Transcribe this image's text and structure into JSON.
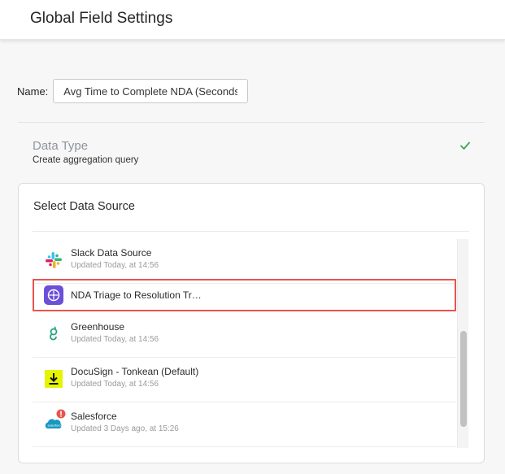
{
  "header": {
    "title": "Global Field Settings"
  },
  "name_field": {
    "label": "Name:",
    "value": "Avg Time to Complete NDA (Seconds"
  },
  "data_type": {
    "title": "Data Type",
    "subtitle": "Create aggregation query",
    "status_icon": "check-icon"
  },
  "data_source_panel": {
    "title": "Select Data Source",
    "items": [
      {
        "title": "Slack Data Source",
        "subtitle": "Updated Today, at 14:56",
        "icon": "slack-icon"
      },
      {
        "title": "NDA Triage to Resolution Tr…",
        "subtitle": "",
        "icon": "workflow-icon",
        "selected": true
      },
      {
        "title": "Greenhouse",
        "subtitle": "Updated Today, at 14:56",
        "icon": "greenhouse-icon"
      },
      {
        "title": "DocuSign - Tonkean (Default)",
        "subtitle": "Updated Today, at 14:56",
        "icon": "docusign-icon"
      },
      {
        "title": "Salesforce",
        "subtitle": "Updated 3 Days ago, at 15:26",
        "icon": "salesforce-icon",
        "badge": "!"
      }
    ]
  },
  "colors": {
    "accent_selected_border": "#e9544c",
    "check_green": "#3aa655",
    "workflow_purple": "#6b4fd8"
  }
}
